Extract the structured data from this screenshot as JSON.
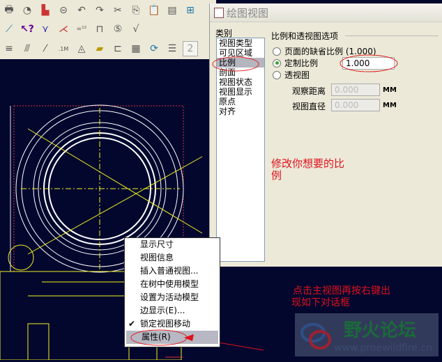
{
  "dialog": {
    "title": "绘图视图",
    "category_label": "类别",
    "categories": [
      "视图类型",
      "可见区域",
      "比例",
      "剖面",
      "视图状态",
      "视图显示",
      "原点",
      "对齐"
    ],
    "selected_category": "比例",
    "group_title": "比例和透视图选项",
    "options": [
      "页面的缺省比例 (1.000)",
      "定制比例",
      "透视图"
    ],
    "selected_option": "定制比例",
    "custom_scale": "1.000",
    "view_distance_label": "观察距离",
    "view_distance": "0.000",
    "view_diameter_label": "视图直径",
    "view_diameter": "0.000",
    "unit": "MM"
  },
  "context_menu": {
    "items": [
      "显示尺寸",
      "视图信息",
      "插入普通视图...",
      "在树中使用模型",
      "设置为活动模型",
      "边显示(E)...",
      "锁定视图移动",
      "属性(R)"
    ],
    "checked": "锁定视图移动",
    "highlighted": "属性(R)"
  },
  "annotations": {
    "modify": "修改你想要的比\n例",
    "click1": "点击主视图再按右键出",
    "click2": "现如下对话框"
  },
  "watermark": {
    "name": "野火论坛",
    "url": "www.proewildfire.cn"
  },
  "toolbar": {
    "dim_text": "2"
  },
  "colors": {
    "canvas": "#03072e",
    "annotation": "#e0101c",
    "drawing": "#f0f020"
  }
}
